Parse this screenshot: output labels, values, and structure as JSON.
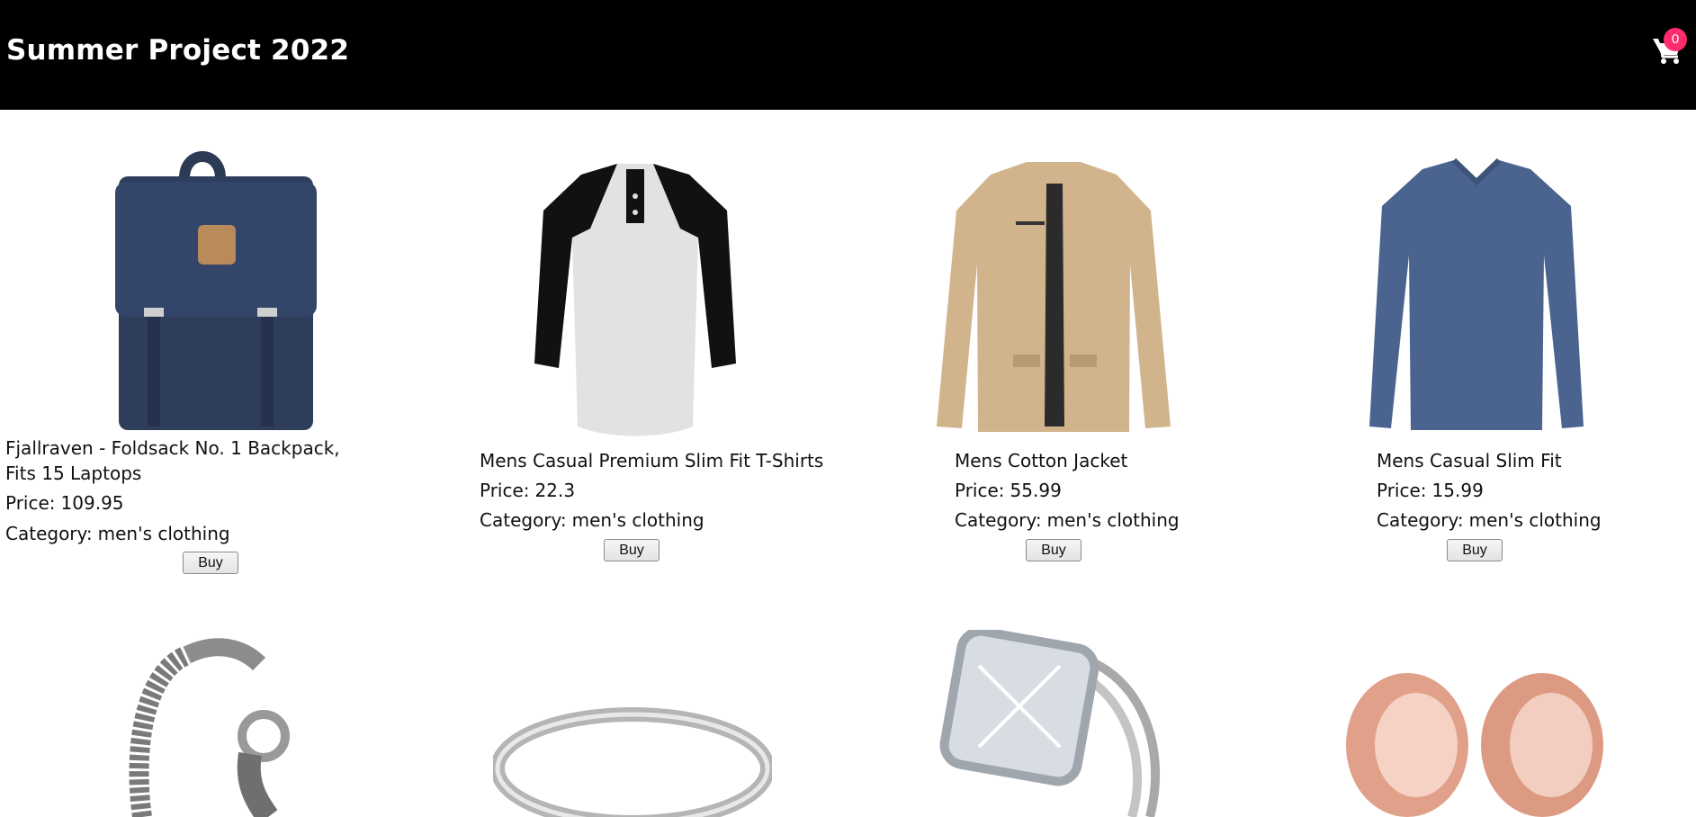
{
  "header": {
    "title": "Summer Project 2022",
    "cart_count": "0",
    "cart_icon": "shopping-cart-icon"
  },
  "labels": {
    "price": "Price:",
    "category": "Category:",
    "buy": "Buy"
  },
  "products": [
    {
      "title": "Fjallraven - Foldsack No. 1 Backpack, Fits 15 Laptops",
      "price": "109.95",
      "category": "men's clothing",
      "image": "backpack"
    },
    {
      "title": "Mens Casual Premium Slim Fit T-Shirts",
      "price": "22.3",
      "category": "men's clothing",
      "image": "raglan-tshirt"
    },
    {
      "title": "Mens Cotton Jacket",
      "price": "55.99",
      "category": "men's clothing",
      "image": "cotton-jacket"
    },
    {
      "title": "Mens Casual Slim Fit",
      "price": "15.99",
      "category": "men's clothing",
      "image": "long-sleeve-shirt"
    },
    {
      "image": "dragon-chain-bracelet"
    },
    {
      "image": "silver-band-ring"
    },
    {
      "image": "diamond-ring-set"
    },
    {
      "image": "rose-gold-tunnel-plugs"
    }
  ],
  "colors": {
    "header_bg": "#000000",
    "badge": "#ff2d6e"
  }
}
